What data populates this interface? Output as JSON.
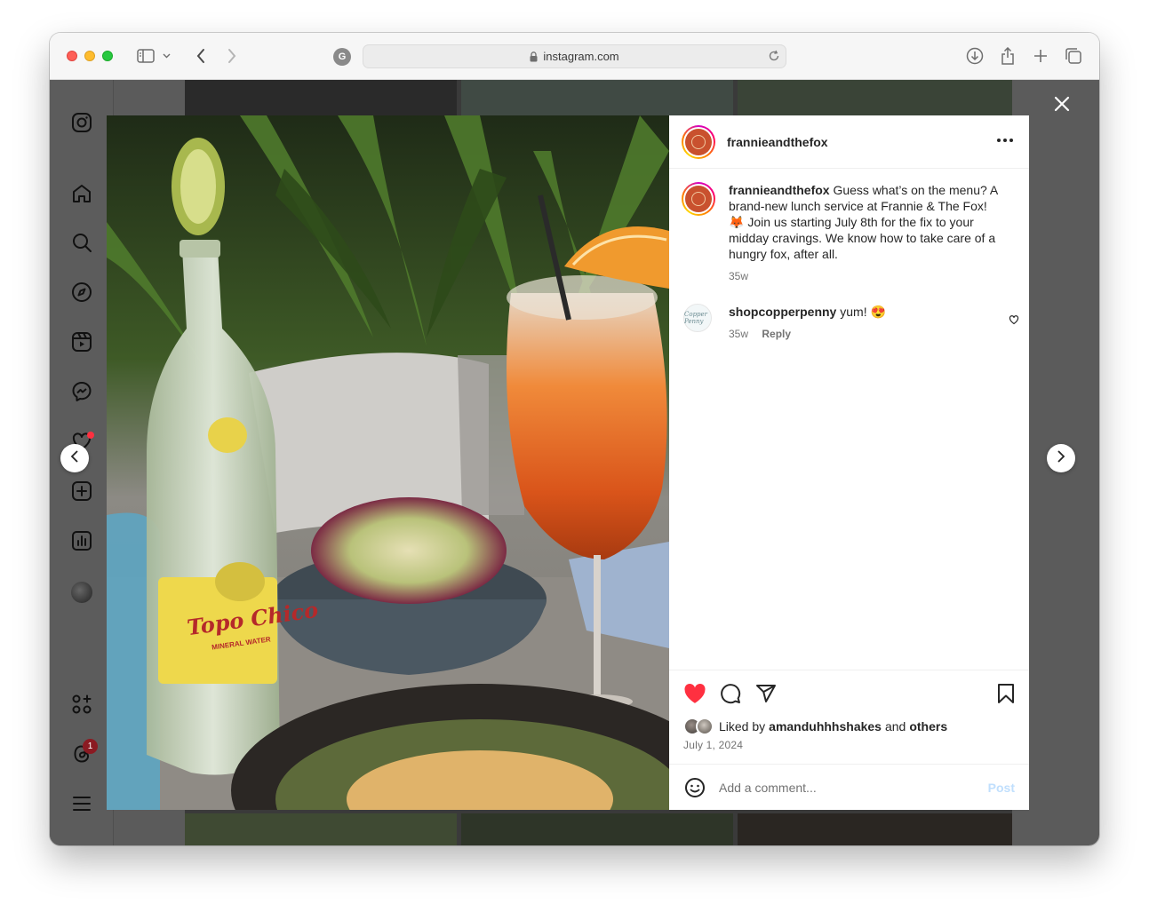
{
  "browser": {
    "url": "instagram.com"
  },
  "post": {
    "username": "frannieandthefox",
    "caption": "Guess what’s on the menu? A brand-new lunch service at Frannie & The Fox! 🦊 Join us starting July 8th for the fix to your midday cravings. We know how to take care of a hungry fox, after all.",
    "caption_time": "35w",
    "comments": [
      {
        "username": "shopcopperpenny",
        "text": "yum! 😍",
        "time": "35w",
        "reply_label": "Reply",
        "avatar_text": "Copper Penny"
      }
    ],
    "liked_by_prefix": "Liked by",
    "liked_by_user": "amanduhhhshakes",
    "liked_by_and": "and",
    "liked_by_others": "others",
    "date": "July 1, 2024",
    "add_comment_placeholder": "Add a comment...",
    "post_label": "Post",
    "liked": true
  },
  "photo": {
    "bottle_label": "Topo Chico",
    "bottle_sub": "MINERAL WATER"
  },
  "sidebar": {
    "threads_badge": "1"
  },
  "colors": {
    "like_red": "#ff3040",
    "link_blue_disabled": "#c0dffd",
    "text_primary": "#262626",
    "text_secondary": "#737373"
  }
}
